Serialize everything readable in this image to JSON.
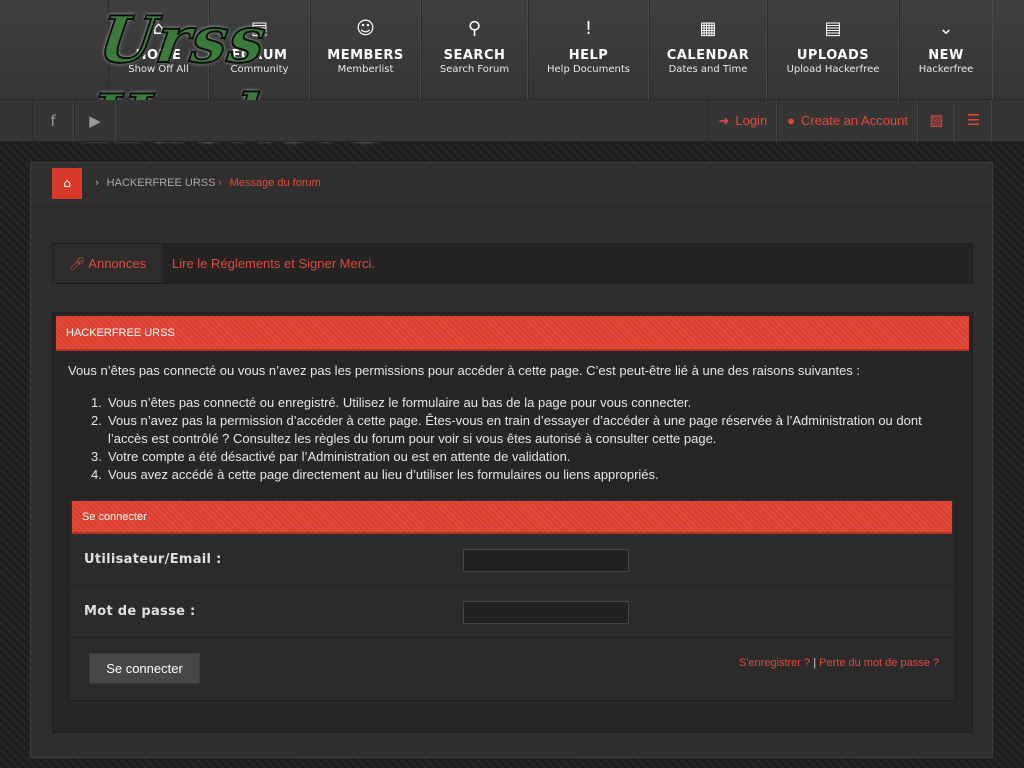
{
  "logo": {
    "text": "Urss Hackers"
  },
  "nav": {
    "items": [
      {
        "icon": "home-icon",
        "glyph": "⌂",
        "title": "HOME",
        "subtitle": "Show Off All"
      },
      {
        "icon": "document-icon",
        "glyph": "▤",
        "title": "FORUM",
        "subtitle": "Community"
      },
      {
        "icon": "users-icon",
        "glyph": "☺",
        "title": "MEMBERS",
        "subtitle": "Memberlist"
      },
      {
        "icon": "search-icon",
        "glyph": "⚲",
        "title": "SEARCH",
        "subtitle": "Search Forum"
      },
      {
        "icon": "exclamation-icon",
        "glyph": "!",
        "title": "HELP",
        "subtitle": "Help Documents"
      },
      {
        "icon": "calendar-icon",
        "glyph": "▦",
        "title": "CALENDAR",
        "subtitle": "Dates and Time"
      },
      {
        "icon": "file-icon",
        "glyph": "▤",
        "title": "UPLOADS",
        "subtitle": "Upload Hackerfree"
      },
      {
        "icon": "chevron-down-icon",
        "glyph": "⌄",
        "title": "NEW",
        "subtitle": "Hackerfree"
      }
    ]
  },
  "social": {
    "facebook": "f",
    "youtube": "▶"
  },
  "header_actions": {
    "login": "Login",
    "register": "Create an Account",
    "login_glyph": "➜",
    "register_glyph": "●",
    "image_glyph": "▨",
    "menu_glyph": "☰"
  },
  "breadcrumb": {
    "home_glyph": "⌂",
    "items": [
      "HACKERFREE URSS",
      "Message du forum"
    ]
  },
  "announcement": {
    "label": "Annonces",
    "text": "Lire le Réglements et Signer Merci."
  },
  "panel": {
    "title": "HACKERFREE URSS",
    "intro": "Vous n’êtes pas connecté ou vous n’avez pas les permissions pour accéder à cette page. C’est peut-être lié à une des raisons suivantes :",
    "reasons": [
      "Vous n’êtes pas connecté ou enregistré. Utilisez le formulaire au bas de la page pour vous connecter.",
      "Vous n’avez pas la permission d’accéder à cette page. Êtes-vous en train d’essayer d’accéder à une page réservée à l’Administration ou dont l’accès est contrôlé ? Consultez les règles du forum pour voir si vous êtes autorisé à consulter cette page.",
      "Votre compte a été désactivé par l’Administration ou est en attente de validation.",
      "Vous avez accédé à cette page directement au lieu d’utiliser les formulaires ou liens appropriés."
    ]
  },
  "login": {
    "title": "Se connecter",
    "user_label": "Utilisateur/Email :",
    "user_value": "",
    "password_label": "Mot de passe :",
    "password_value": "",
    "submit": "Se connecter",
    "register_link": "S'enregistrer ?",
    "separator": "|",
    "lost_password_link": "Perte du mot de passe ?"
  },
  "colors": {
    "accent": "#e3493b",
    "background": "#222222"
  }
}
